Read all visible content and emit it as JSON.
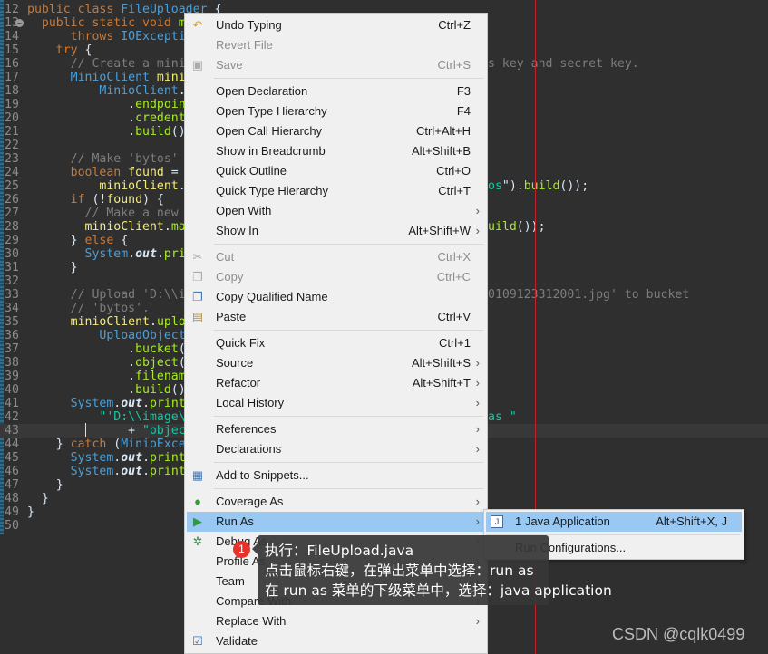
{
  "editor": {
    "lines": [
      {
        "n": "12",
        "t": [
          [
            "public class ",
            "kw"
          ],
          [
            "FileUploader",
            "ty"
          ],
          [
            " {",
            ""
          ]
        ]
      },
      {
        "n": "13",
        "t": [
          [
            "  public static void ",
            "kw"
          ],
          [
            "mair",
            "me"
          ]
        ],
        "fold": true
      },
      {
        "n": "14",
        "t": [
          [
            "      throws ",
            "kw"
          ],
          [
            "IOException,",
            "ty"
          ]
        ]
      },
      {
        "n": "15",
        "t": [
          [
            "    try ",
            "kw"
          ],
          [
            "{",
            ""
          ]
        ]
      },
      {
        "n": "16",
        "t": [
          [
            "      // Create a minioCl",
            "cm"
          ]
        ],
        "right": [
          [
            "s key and secret key.",
            "cm"
          ]
        ]
      },
      {
        "n": "17",
        "t": [
          [
            "      MinioClient ",
            "ty"
          ],
          [
            "minioCl",
            "va"
          ]
        ]
      },
      {
        "n": "18",
        "t": [
          [
            "          MinioClient",
            "ty"
          ],
          [
            ".",
            ""
          ],
          [
            "bui",
            "it"
          ]
        ]
      },
      {
        "n": "19",
        "t": [
          [
            "              .",
            ""
          ],
          [
            "endpoint",
            "me"
          ],
          [
            "('",
            ""
          ]
        ]
      },
      {
        "n": "20",
        "t": [
          [
            "              .",
            ""
          ],
          [
            "credential",
            "me"
          ]
        ]
      },
      {
        "n": "21",
        "t": [
          [
            "              .",
            ""
          ],
          [
            "build",
            "me"
          ],
          [
            "();",
            ""
          ]
        ]
      },
      {
        "n": "22",
        "t": []
      },
      {
        "n": "23",
        "t": [
          [
            "      // Make 'bytos' buc",
            "cm"
          ]
        ]
      },
      {
        "n": "24",
        "t": [
          [
            "      boolean ",
            "kw"
          ],
          [
            "found",
            "va"
          ],
          [
            " =",
            ""
          ]
        ]
      },
      {
        "n": "25",
        "t": [
          [
            "          minioClient",
            "va"
          ],
          [
            ".",
            ""
          ],
          [
            "buc",
            "me"
          ]
        ],
        "right": [
          [
            "os",
            "st"
          ],
          [
            "\").",
            ""
          ],
          [
            "build",
            "me"
          ],
          [
            "());",
            ""
          ]
        ]
      },
      {
        "n": "26",
        "t": [
          [
            "      if ",
            "kw"
          ],
          [
            "(!",
            ""
          ],
          [
            "found",
            "va"
          ],
          [
            ") {",
            ""
          ]
        ]
      },
      {
        "n": "27",
        "t": [
          [
            "        // Make a new buc",
            "cm"
          ]
        ]
      },
      {
        "n": "28",
        "t": [
          [
            "        minioClient",
            "va"
          ],
          [
            ".",
            ""
          ],
          [
            "makeE",
            "me"
          ]
        ],
        "right": [
          [
            "uild",
            "me"
          ],
          [
            "());",
            ""
          ]
        ]
      },
      {
        "n": "29",
        "t": [
          [
            "      } ",
            ""
          ],
          [
            "else ",
            "kw"
          ],
          [
            "{",
            ""
          ]
        ]
      },
      {
        "n": "30",
        "t": [
          [
            "        System",
            "ty"
          ],
          [
            ".",
            ""
          ],
          [
            "out",
            "fi"
          ],
          [
            ".",
            ""
          ],
          [
            "printl",
            "me"
          ]
        ]
      },
      {
        "n": "31",
        "t": [
          [
            "      }",
            ""
          ]
        ]
      },
      {
        "n": "32",
        "t": []
      },
      {
        "n": "33",
        "t": [
          [
            "      // Upload 'D:\\\\imag",
            "cm"
          ]
        ],
        "right": [
          [
            "0109123312001.jpg' to bucket",
            "cm"
          ]
        ]
      },
      {
        "n": "34",
        "t": [
          [
            "      // 'bytos'.",
            "cm"
          ]
        ]
      },
      {
        "n": "35",
        "t": [
          [
            "      minioClient",
            "va"
          ],
          [
            ".",
            ""
          ],
          [
            "uploadC",
            "me"
          ]
        ]
      },
      {
        "n": "36",
        "t": [
          [
            "          UploadObjectArg",
            "ty"
          ]
        ]
      },
      {
        "n": "37",
        "t": [
          [
            "              .",
            ""
          ],
          [
            "bucket",
            "me"
          ],
          [
            "(\"",
            ""
          ],
          [
            "by",
            "st"
          ]
        ]
      },
      {
        "n": "38",
        "t": [
          [
            "              .",
            ""
          ],
          [
            "object",
            "me"
          ],
          [
            "(\"",
            ""
          ],
          [
            "20",
            "st"
          ]
        ]
      },
      {
        "n": "39",
        "t": [
          [
            "              .",
            ""
          ],
          [
            "filename",
            "me"
          ],
          [
            "('",
            ""
          ]
        ]
      },
      {
        "n": "40",
        "t": [
          [
            "              .",
            ""
          ],
          [
            "build",
            "me"
          ],
          [
            "());",
            ""
          ]
        ]
      },
      {
        "n": "41",
        "t": [
          [
            "      System",
            "ty"
          ],
          [
            ".",
            ""
          ],
          [
            "out",
            "fi"
          ],
          [
            ".",
            ""
          ],
          [
            "println",
            "me"
          ],
          [
            "(",
            ""
          ]
        ]
      },
      {
        "n": "42",
        "t": [
          [
            "          \"'D:\\\\image\\\\IN",
            "st"
          ]
        ],
        "right": [
          [
            "as \"",
            "st"
          ]
        ]
      },
      {
        "n": "43",
        "t": [
          [
            "              + ",
            ""
          ],
          [
            "\"object '",
            "st"
          ]
        ],
        "current": true
      },
      {
        "n": "44",
        "t": [
          [
            "    } ",
            ""
          ],
          [
            "catch ",
            "kw"
          ],
          [
            "(",
            ""
          ],
          [
            "MinioExcepti",
            "ty"
          ]
        ]
      },
      {
        "n": "45",
        "t": [
          [
            "      System",
            "ty"
          ],
          [
            ".",
            ""
          ],
          [
            "out",
            "fi"
          ],
          [
            ".",
            ""
          ],
          [
            "println",
            "me"
          ],
          [
            "(",
            ""
          ]
        ]
      },
      {
        "n": "46",
        "t": [
          [
            "      System",
            "ty"
          ],
          [
            ".",
            ""
          ],
          [
            "out",
            "fi"
          ],
          [
            ".",
            ""
          ],
          [
            "println",
            "me"
          ],
          [
            "(",
            ""
          ]
        ]
      },
      {
        "n": "47",
        "t": [
          [
            "    }",
            ""
          ]
        ]
      },
      {
        "n": "48",
        "t": [
          [
            "  }",
            ""
          ]
        ]
      },
      {
        "n": "49",
        "t": [
          [
            "}",
            ""
          ]
        ]
      },
      {
        "n": "50",
        "t": []
      }
    ]
  },
  "context_menu": {
    "items": [
      {
        "label": "Undo Typing",
        "shortcut": "Ctrl+Z",
        "icon": "undo-icon",
        "glyph": "↶"
      },
      {
        "label": "Revert File",
        "disabled": true
      },
      {
        "label": "Save",
        "shortcut": "Ctrl+S",
        "disabled": true,
        "icon": "save-icon",
        "glyph": "▣"
      },
      {
        "sep": true
      },
      {
        "label": "Open Declaration",
        "shortcut": "F3"
      },
      {
        "label": "Open Type Hierarchy",
        "shortcut": "F4"
      },
      {
        "label": "Open Call Hierarchy",
        "shortcut": "Ctrl+Alt+H"
      },
      {
        "label": "Show in Breadcrumb",
        "shortcut": "Alt+Shift+B"
      },
      {
        "label": "Quick Outline",
        "shortcut": "Ctrl+O"
      },
      {
        "label": "Quick Type Hierarchy",
        "shortcut": "Ctrl+T"
      },
      {
        "label": "Open With",
        "submenu": true
      },
      {
        "label": "Show In",
        "shortcut": "Alt+Shift+W",
        "submenu": true
      },
      {
        "sep": true
      },
      {
        "label": "Cut",
        "shortcut": "Ctrl+X",
        "disabled": true,
        "icon": "scissors-icon",
        "glyph": "✂"
      },
      {
        "label": "Copy",
        "shortcut": "Ctrl+C",
        "disabled": true,
        "icon": "copy-icon",
        "glyph": "❐"
      },
      {
        "label": "Copy Qualified Name",
        "icon": "copy-qualified-name-icon",
        "glyph": "❐"
      },
      {
        "label": "Paste",
        "shortcut": "Ctrl+V",
        "icon": "paste-icon",
        "glyph": "▤"
      },
      {
        "sep": true
      },
      {
        "label": "Quick Fix",
        "shortcut": "Ctrl+1"
      },
      {
        "label": "Source",
        "shortcut": "Alt+Shift+S",
        "submenu": true
      },
      {
        "label": "Refactor",
        "shortcut": "Alt+Shift+T",
        "submenu": true
      },
      {
        "label": "Local History",
        "submenu": true
      },
      {
        "sep": true
      },
      {
        "label": "References",
        "submenu": true
      },
      {
        "label": "Declarations",
        "submenu": true
      },
      {
        "sep": true
      },
      {
        "label": "Add to Snippets...",
        "icon": "snippet-icon",
        "glyph": "▦"
      },
      {
        "sep": true
      },
      {
        "label": "Coverage As",
        "submenu": true,
        "icon": "coverage-icon",
        "glyph": "●"
      },
      {
        "label": "Run As",
        "submenu": true,
        "selected": true,
        "icon": "run-icon",
        "glyph": "▶"
      },
      {
        "label": "Debug As",
        "submenu": true,
        "icon": "bug-icon",
        "glyph": "✲"
      },
      {
        "label": "Profile As",
        "submenu": true
      },
      {
        "label": "Team",
        "submenu": true
      },
      {
        "label": "Compare With",
        "submenu": true
      },
      {
        "label": "Replace With",
        "submenu": true
      },
      {
        "label": "Validate",
        "icon": "checkbox-icon",
        "glyph": "☑"
      }
    ]
  },
  "run_as_submenu": {
    "items": [
      {
        "label": "1 Java Application",
        "shortcut": "Alt+Shift+X, J",
        "selected": true,
        "icon": "java-app-icon",
        "glyph": "J"
      },
      {
        "label": "Run Configurations..."
      }
    ]
  },
  "annotation": {
    "badge": "1",
    "lines": [
      "执行：FileUpload.java",
      "点击鼠标右键，在弹出菜单中选择：run as",
      "在 run as 菜单的下级菜单中，选择：java application"
    ]
  },
  "watermark": "CSDN @cqlk0499",
  "colors": {
    "editor_bg": "#2f2f2f",
    "menu_bg": "#f0f0f0",
    "selection": "#99c9f2",
    "print_margin": "#c0222a",
    "badge": "#e9312c"
  }
}
